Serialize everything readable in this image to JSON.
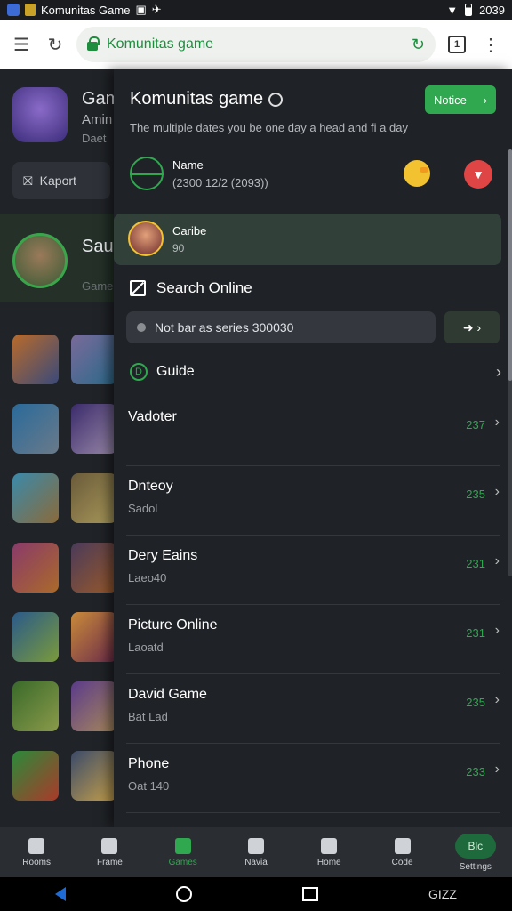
{
  "status_bar": {
    "title": "Komunitas Game",
    "time": "2039"
  },
  "browser": {
    "url": "Komunitas game",
    "tab_count": "1"
  },
  "background": {
    "title": "Gam",
    "sub1": "Amin",
    "sub2": "Daet",
    "report_label": "Kaport",
    "title2": "Saul",
    "sub3": "Gamen"
  },
  "panel": {
    "title": "Komunitas game",
    "notice_button": "Notice",
    "description": "The multiple dates you be one day a head and fi a day",
    "user": {
      "name": "Name",
      "meta": "(2300 12/2 (2093))"
    },
    "highlight": {
      "name": "Caribe",
      "count": "90"
    },
    "search_title": "Search Online",
    "filter_text": "Not bar as series 300030",
    "guide_label": "Guide",
    "rows": [
      {
        "title": "Vadoter",
        "sub": "",
        "num": "237"
      },
      {
        "title": "Dnteoy",
        "sub": "Sadol",
        "num": "235"
      },
      {
        "title": "Dery Eains",
        "sub": "Laeo40",
        "num": "231"
      },
      {
        "title": "Picture Online",
        "sub": "Laoatd",
        "num": "231"
      },
      {
        "title": "David Game",
        "sub": "Bat Lad",
        "num": "235"
      },
      {
        "title": "Phone",
        "sub": "Oat 140",
        "num": "233"
      }
    ]
  },
  "bottom_nav": [
    {
      "label": "Rooms"
    },
    {
      "label": "Frame"
    },
    {
      "label": "Games"
    },
    {
      "label": "Navia"
    },
    {
      "label": "Home"
    },
    {
      "label": "Code"
    },
    {
      "label": "Settings",
      "chip": "Blc"
    }
  ],
  "watermark": "GIZZ"
}
